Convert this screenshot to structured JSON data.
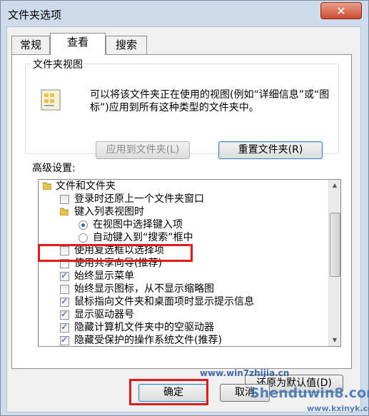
{
  "window": {
    "title": "文件夹选项",
    "close_label": "✕"
  },
  "tabs": [
    {
      "label": "常规"
    },
    {
      "label": "查看"
    },
    {
      "label": "搜索"
    }
  ],
  "folder_views": {
    "legend": "文件夹视图",
    "description": "可以将该文件夹正在使用的视图(例如“详细信息”或“图标”)应用到所有这种类型的文件夹中。",
    "apply_button": "应用到文件夹(L)",
    "reset_button": "重置文件夹(R)"
  },
  "advanced": {
    "legend": "高级设置:",
    "items": [
      {
        "label": "文件和文件夹"
      },
      {
        "label": "登录时还原上一个文件夹窗口"
      },
      {
        "label": "键入列表视图时"
      },
      {
        "label": "在视图中选择键入项"
      },
      {
        "label": "自动键入到“搜索”框中"
      },
      {
        "label": "使用复选框以选择项"
      },
      {
        "label": "使用共享向导(推荐)"
      },
      {
        "label": "始终显示菜单"
      },
      {
        "label": "始终显示图标，从不显示缩略图"
      },
      {
        "label": "鼠标指向文件夹和桌面项时显示提示信息"
      },
      {
        "label": "显示驱动器号"
      },
      {
        "label": "隐藏计算机文件夹中的空驱动器"
      },
      {
        "label": "隐藏受保护的操作系统文件(推荐)"
      }
    ],
    "restore_button": "还原为默认值(D)"
  },
  "footer": {
    "ok_button": "确定",
    "cancel_button": "取消"
  },
  "watermarks": {
    "top": "www.win7zhijia.cn",
    "brand": "Shenduwin8.com",
    "url": "www.kxinyk.com"
  },
  "colors": {
    "highlight": "#e01a1a",
    "title_bar": "#cddbeb"
  }
}
